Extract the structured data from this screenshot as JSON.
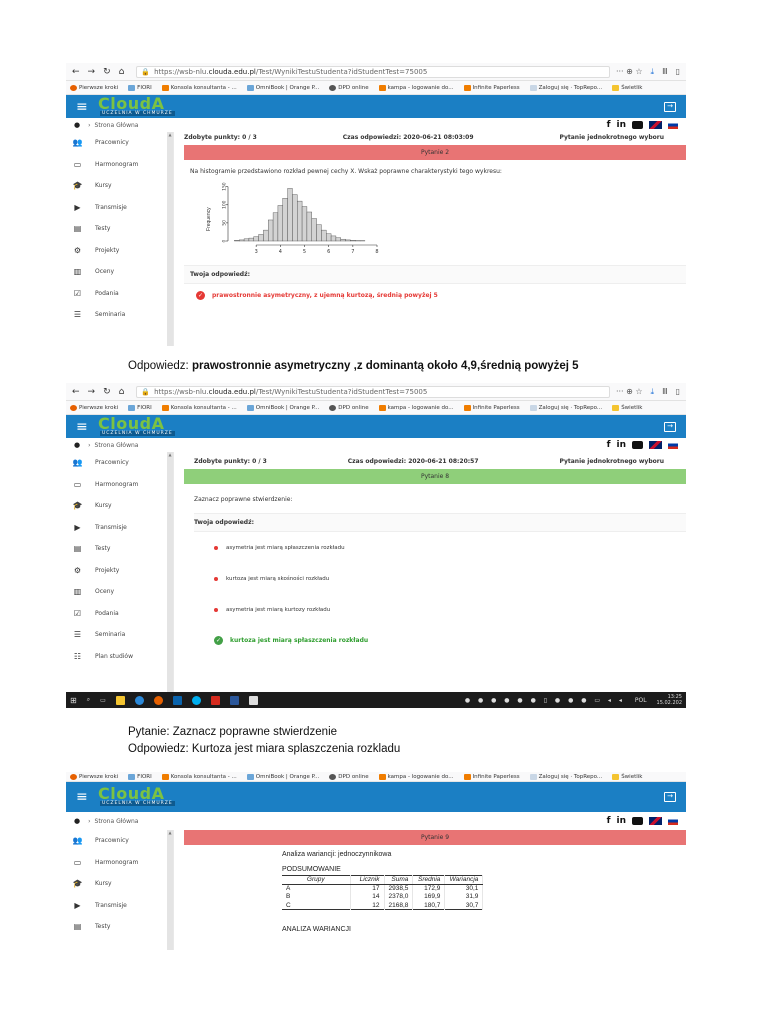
{
  "browser": {
    "url_prefix": "https://wsb-nlu.",
    "url_host": "clouda.edu.pl",
    "url_path": "/Test/WynikiTestuStudenta?idStudentTest=75005",
    "menu": "··· ⊕ ☆"
  },
  "bookmarks": [
    {
      "label": "Pierwsze kroki",
      "kind": "fire"
    },
    {
      "label": "FIORI",
      "kind": "bm"
    },
    {
      "label": "Konsola konsultanta - ...",
      "kind": "orange"
    },
    {
      "label": "OmniBook | Orange P...",
      "kind": "bm"
    },
    {
      "label": "DPD online",
      "kind": "globe"
    },
    {
      "label": "kampa - logowanie do...",
      "kind": "orange"
    },
    {
      "label": "Infinite Paperless",
      "kind": "orange"
    },
    {
      "label": "Zaloguj się · TopRepo...",
      "kind": "sheet"
    },
    {
      "label": "Świetlik",
      "kind": "star"
    }
  ],
  "app": {
    "logo": "CloudA",
    "logo_sub": "UCZELNIA W CHMURZE",
    "breadcrumb": "Strona Główna",
    "social": [
      "f",
      "in"
    ]
  },
  "sidebar_items": [
    {
      "label": "Pracownicy",
      "icon": "users-icon",
      "glyph": "👥"
    },
    {
      "label": "Harmonogram",
      "icon": "calendar-icon",
      "glyph": "▭"
    },
    {
      "label": "Kursy",
      "icon": "graduation-cap-icon",
      "glyph": "🎓"
    },
    {
      "label": "Transmisje",
      "icon": "video-icon",
      "glyph": "▶"
    },
    {
      "label": "Testy",
      "icon": "document-icon",
      "glyph": "▤"
    },
    {
      "label": "Projekty",
      "icon": "projects-icon",
      "glyph": "⚙"
    },
    {
      "label": "Oceny",
      "icon": "grades-icon",
      "glyph": "▥"
    },
    {
      "label": "Podania",
      "icon": "checkbox-icon",
      "glyph": "☑"
    },
    {
      "label": "Seminaria",
      "icon": "list-icon",
      "glyph": "☰"
    },
    {
      "label": "Plan studiów",
      "icon": "plan-icon",
      "glyph": "☷"
    }
  ],
  "shot1": {
    "points": "Zdobyte punkty: 0 / 3",
    "time": "Czas odpowiedzi: 2020-06-21 08:03:09",
    "type": "Pytanie jednokrotnego wyboru",
    "question_title": "Pytanie 2",
    "question_text": "Na histogramie przedstawiono rozkład pewnej cechy X. Wskaż poprawne charakterystyki tego wykresu:",
    "your_answer": "Twoja odpowiedź:",
    "answer": "prawostronnie asymetryczny, z ujemną kurtozą, średnią powyżej 5"
  },
  "caption1": {
    "lead": "Odpowiedz: ",
    "bold": "prawostronnie asymetryczny  ,z dominantą około 4,9,średnią powyżej 5"
  },
  "shot2": {
    "points": "Zdobyte punkty: 0 / 3",
    "time": "Czas odpowiedzi: 2020-06-21 08:20:57",
    "type": "Pytanie jednokrotnego wyboru",
    "question_title": "Pytanie 8",
    "question_text": "Zaznacz poprawne stwierdzenie:",
    "your_answer": "Twoja odpowiedź:",
    "options": [
      "asymetria jest miarą spłaszczenia rozkładu",
      "kurtoza jest miarą skośności rozkładu",
      "asymetria jest miarą kurtozy rozkładu"
    ],
    "answer": "kurtoza jest miarą spłaszczenia rozkładu",
    "taskbar_lang": "POL",
    "taskbar_time": "13:25",
    "taskbar_date": "15.02.202"
  },
  "caption2": {
    "line1": "Pytanie: Zaznacz poprawne stwierdzenie",
    "line2": "Odpowiedz: Kurtoza jest miara splaszczenia rozkladu"
  },
  "shot3": {
    "question_title": "Pytanie 9",
    "table_title": "Analiza wariancji: jednoczynnikowa",
    "summary": "PODSUMOWANIE",
    "headers": [
      "Grupy",
      "Licznik",
      "Suma",
      "Średnia",
      "Wariancja"
    ],
    "rows": [
      [
        "A",
        "17",
        "2938,5",
        "172,9",
        "30,1"
      ],
      [
        "B",
        "14",
        "2378,0",
        "169,9",
        "31,9"
      ],
      [
        "C",
        "12",
        "2168,8",
        "180,7",
        "30,7"
      ]
    ],
    "anova_heading": "ANALIZA WARIANCJI"
  },
  "chart_data": {
    "type": "bar",
    "ylabel": "Frequency",
    "x_ticks": [
      "3",
      "4",
      "5",
      "6",
      "7",
      "8"
    ],
    "y_ticks": [
      "0",
      "50",
      "100",
      "150"
    ],
    "bin_start": 2.1,
    "bin_width": 0.2,
    "values": [
      2,
      3,
      6,
      8,
      12,
      18,
      30,
      58,
      78,
      98,
      118,
      145,
      128,
      110,
      95,
      80,
      62,
      45,
      30,
      20,
      14,
      9,
      5,
      3,
      2,
      1,
      1
    ],
    "ylim": [
      0,
      160
    ],
    "xlim": [
      2,
      8
    ]
  },
  "colors": {
    "appbar": "#1b7fc4",
    "logo": "#7cc242",
    "band_wrong": "#e87474",
    "band_right": "#8fcf7a"
  }
}
